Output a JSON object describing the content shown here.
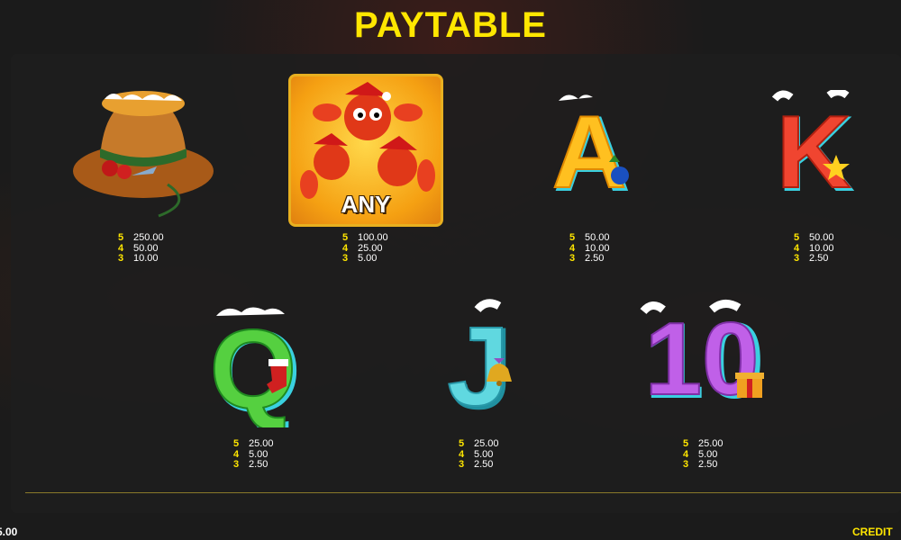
{
  "title": "PAYTABLE",
  "symbols": [
    {
      "id": "bucket-hat",
      "pays": [
        {
          "n": "5",
          "v": "250.00"
        },
        {
          "n": "4",
          "v": "50.00"
        },
        {
          "n": "3",
          "v": "10.00"
        }
      ]
    },
    {
      "id": "lobster-any",
      "label": "ANY",
      "pays": [
        {
          "n": "5",
          "v": "100.00"
        },
        {
          "n": "4",
          "v": "25.00"
        },
        {
          "n": "3",
          "v": "5.00"
        }
      ]
    },
    {
      "id": "letter-a",
      "glyph": "A",
      "pays": [
        {
          "n": "5",
          "v": "50.00"
        },
        {
          "n": "4",
          "v": "10.00"
        },
        {
          "n": "3",
          "v": "2.50"
        }
      ]
    },
    {
      "id": "letter-k",
      "glyph": "K",
      "pays": [
        {
          "n": "5",
          "v": "50.00"
        },
        {
          "n": "4",
          "v": "10.00"
        },
        {
          "n": "3",
          "v": "2.50"
        }
      ]
    },
    {
      "id": "letter-q",
      "glyph": "Q",
      "pays": [
        {
          "n": "5",
          "v": "25.00"
        },
        {
          "n": "4",
          "v": "5.00"
        },
        {
          "n": "3",
          "v": "2.50"
        }
      ]
    },
    {
      "id": "letter-j",
      "glyph": "J",
      "pays": [
        {
          "n": "5",
          "v": "25.00"
        },
        {
          "n": "4",
          "v": "5.00"
        },
        {
          "n": "3",
          "v": "2.50"
        }
      ]
    },
    {
      "id": "number-10",
      "glyph": "10",
      "pays": [
        {
          "n": "5",
          "v": "25.00"
        },
        {
          "n": "4",
          "v": "5.00"
        },
        {
          "n": "3",
          "v": "2.50"
        }
      ]
    }
  ],
  "footer": {
    "balance_fragment": "5.00",
    "credit_label": "CREDIT"
  },
  "colors": {
    "title": "#ffe600",
    "count": "#ffe600",
    "value": "#ffffff",
    "letter_a": "#ffc020",
    "letter_k": "#f04530",
    "letter_q": "#55d040",
    "letter_j": "#60d8e0",
    "number_10": "#c060e8"
  }
}
